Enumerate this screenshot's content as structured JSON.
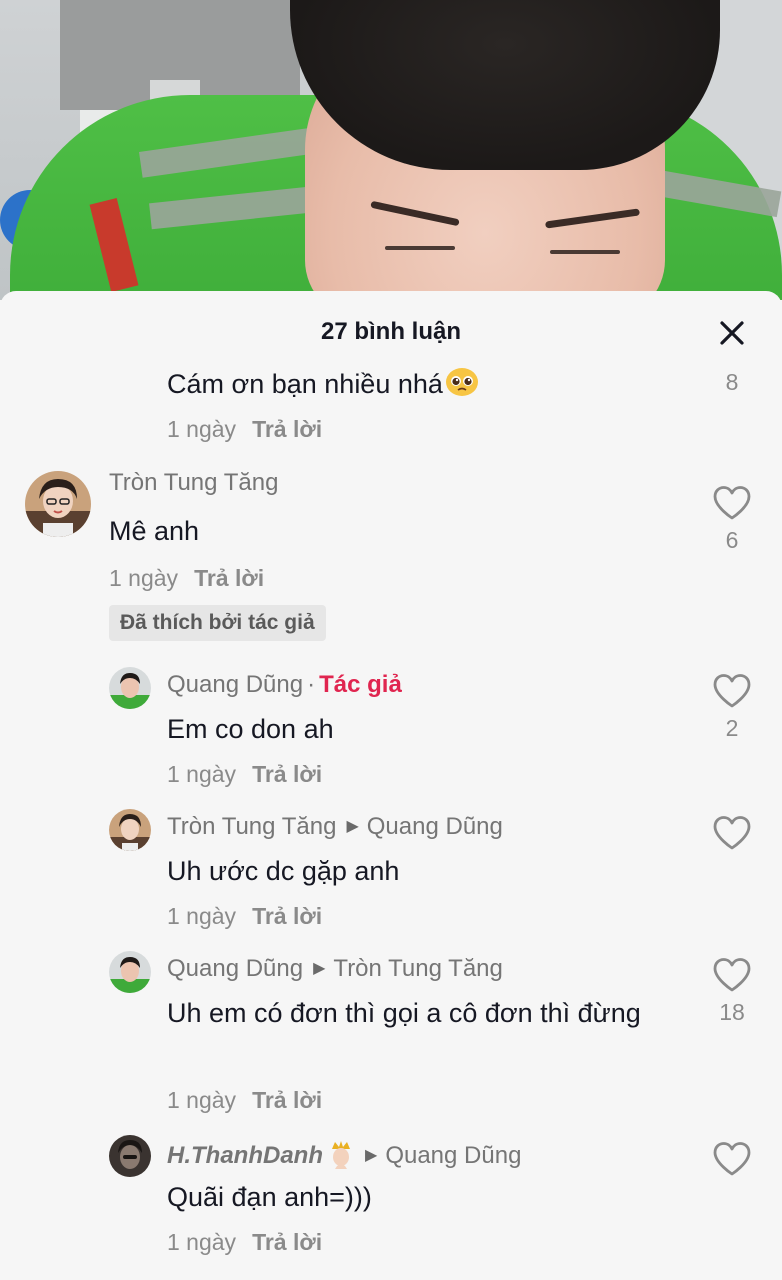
{
  "header": {
    "title": "27 bình luận",
    "close_icon": "close-icon"
  },
  "comments": [
    {
      "text": "Cám ơn bạn nhiều nhá",
      "emoji": "pleading-face-emoji",
      "time": "1 ngày",
      "reply_label": "Trả lời",
      "likes": "8"
    },
    {
      "name": "Tròn Tung Tăng",
      "text": "Mê anh",
      "time": "1 ngày",
      "reply_label": "Trả lời",
      "likes": "6",
      "badge": "Đã thích bởi tác giả"
    },
    {
      "name": "Quang Dũng",
      "author_tag": "Tác giả",
      "text": "Em co don ah",
      "time": "1 ngày",
      "reply_label": "Trả lời",
      "likes": "2"
    },
    {
      "name": "Tròn Tung Tăng",
      "reply_to": "Quang Dũng",
      "text": "Uh ước dc gặp anh",
      "time": "1 ngày",
      "reply_label": "Trả lời",
      "likes": ""
    },
    {
      "name": "Quang Dũng",
      "reply_to": "Tròn Tung Tăng",
      "text": "Uh em có đơn thì gọi a cô đơn thì đừng",
      "time": "1 ngày",
      "reply_label": "Trả lời",
      "likes": "18"
    },
    {
      "name": "H.ThanhDanh",
      "name_emoji": "crown-person-emoji",
      "reply_to": "Quang Dũng",
      "text": "Quãi đạn anh=)))",
      "time": "1 ngày",
      "reply_label": "Trả lời",
      "likes": ""
    }
  ],
  "colors": {
    "author_tag": "#e0254f",
    "text_primary": "#161823",
    "text_secondary": "#757575",
    "sheet_bg": "#f6f6f6"
  }
}
